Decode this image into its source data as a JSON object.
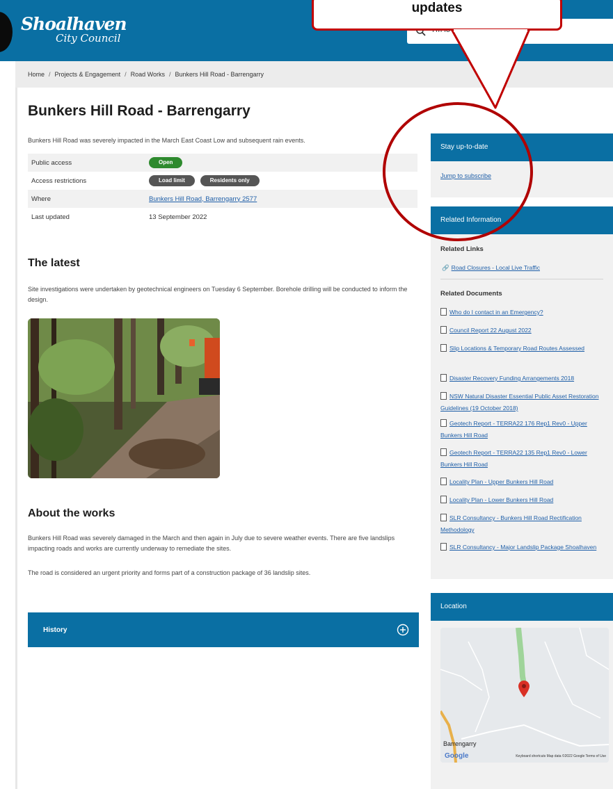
{
  "header": {
    "logo_main": "Shoalhaven",
    "logo_sub": "City Council",
    "search_placeholder": "I'm lo"
  },
  "breadcrumb": [
    "Home",
    "Projects & Engagement",
    "Road Works",
    "Bunkers Hill Road - Barrengarry"
  ],
  "breadcrumb_sep": "/",
  "page": {
    "title": "Bunkers Hill Road - Barrengarry",
    "intro": "Bunkers Hill Road was severely impacted in the March East Coast Low and subsequent rain events."
  },
  "info": {
    "public_access_label": "Public access",
    "public_access_value": "Open",
    "restrictions_label": "Access restrictions",
    "restriction_1": "Load limit",
    "restriction_2": "Residents only",
    "where_label": "Where",
    "where_value": "Bunkers Hill Road, Barrengarry 2577",
    "updated_label": "Last updated",
    "updated_value": "13 September 2022"
  },
  "latest": {
    "heading": "The latest",
    "text": "Site investigations were undertaken by geotechnical engineers on Tuesday 6 September. Borehole drilling will be conducted to inform the design."
  },
  "works": {
    "heading": "About the works",
    "para1": "Bunkers Hill Road was severely damaged in the March and then again in July due to severe weather events. There are five landslips impacting roads and works are currently underway to remediate the sites.",
    "para2": "The road is considered an urgent priority and forms part of a construction package of 36 landslip sites."
  },
  "history": {
    "label": "History"
  },
  "sidebar": {
    "stay_heading": "Stay up-to-date",
    "subscribe_link": "Jump to subscribe",
    "related_heading": "Related Information",
    "links_heading": "Related Links",
    "link_1": "Road Closures - Local Live Traffic",
    "docs_heading": "Related Documents",
    "docs": [
      "Who do I contact in an Emergency?",
      "Council Report 22 August 2022",
      "Slip Locations & Temporary Road Routes Assessed",
      "Disaster Recovery Funding Arrangements 2018",
      "NSW Natural Disaster Essential Public Asset Restoration Guidelines (19 October 2018)",
      "Geotech Report - TERRA22 176 Rep1 Rev0 - Upper Bunkers Hill Road",
      "Geotech Report - TERRA22 135 Rep1 Rev0 - Lower Bunkers Hill Road",
      "Locality Plan - Upper Bunkers Hill Road",
      "Locality Plan - Lower Bunkers Hill Road",
      "SLR Consultancy - Bunkers Hill Road Rectification Methodology",
      "SLR Consultancy - Major Landslip Package Shoalhaven"
    ],
    "location_heading": "Location",
    "map_place": "Barrengarry",
    "map_google": "Google",
    "map_attribution": "Keyboard shortcuts   Map data ©2022 Google   Terms of Use"
  },
  "annotation": {
    "callout_text": "updates"
  },
  "colors": {
    "brand": "#0a6fa3",
    "open": "#2e8a2e",
    "tag": "#555555",
    "annotation": "#c00000"
  }
}
